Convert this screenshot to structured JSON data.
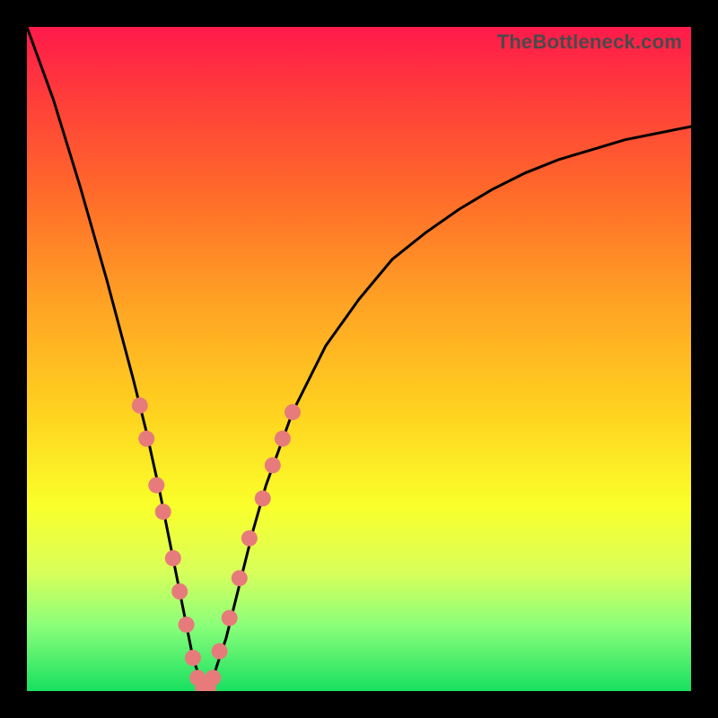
{
  "watermark": "TheBottleneck.com",
  "chart_data": {
    "type": "line",
    "title": "",
    "xlabel": "",
    "ylabel": "",
    "xlim": [
      0,
      100
    ],
    "ylim": [
      0,
      100
    ],
    "grid": false,
    "legend": false,
    "series": [
      {
        "name": "bottleneck-curve",
        "x": [
          0,
          4,
          8,
          12,
          16,
          18,
          20,
          22,
          24,
          25,
          26,
          27,
          28,
          30,
          32,
          34,
          36,
          40,
          45,
          50,
          55,
          60,
          65,
          70,
          75,
          80,
          85,
          90,
          95,
          100
        ],
        "y": [
          100,
          89,
          76,
          62,
          47,
          39,
          30,
          20,
          10,
          5,
          2,
          0,
          2,
          8,
          16,
          24,
          31,
          42,
          52,
          59,
          65,
          69,
          72.5,
          75.5,
          78,
          80,
          81.5,
          83,
          84,
          85
        ],
        "color": "#000000"
      }
    ],
    "markers": {
      "name": "highlight-dots",
      "color": "#e77b7b",
      "radius_px": 9,
      "points": [
        {
          "x": 17.0,
          "y": 43
        },
        {
          "x": 18.0,
          "y": 38
        },
        {
          "x": 19.5,
          "y": 31
        },
        {
          "x": 20.5,
          "y": 27
        },
        {
          "x": 22.0,
          "y": 20
        },
        {
          "x": 23.0,
          "y": 15
        },
        {
          "x": 24.0,
          "y": 10
        },
        {
          "x": 25.0,
          "y": 5
        },
        {
          "x": 25.7,
          "y": 2
        },
        {
          "x": 26.5,
          "y": 0.5
        },
        {
          "x": 27.3,
          "y": 0.5
        },
        {
          "x": 28.0,
          "y": 2
        },
        {
          "x": 29.0,
          "y": 6
        },
        {
          "x": 30.5,
          "y": 11
        },
        {
          "x": 32.0,
          "y": 17
        },
        {
          "x": 33.5,
          "y": 23
        },
        {
          "x": 35.5,
          "y": 29
        },
        {
          "x": 37.0,
          "y": 34
        },
        {
          "x": 38.5,
          "y": 38
        },
        {
          "x": 40.0,
          "y": 42
        }
      ]
    }
  }
}
